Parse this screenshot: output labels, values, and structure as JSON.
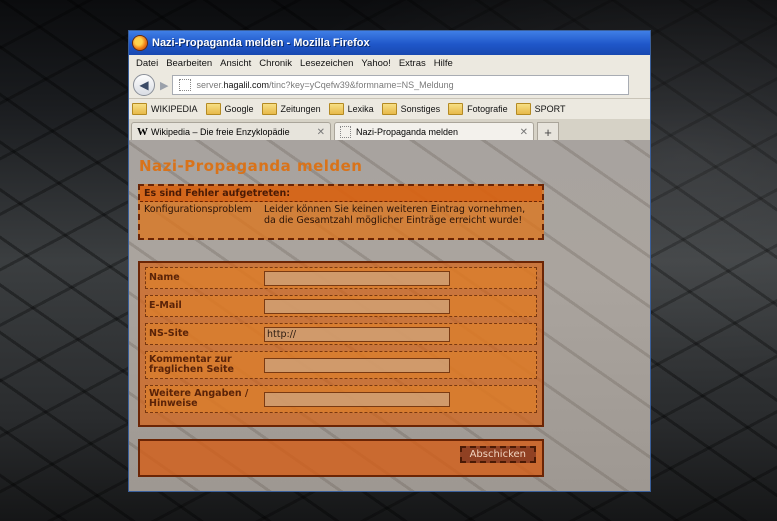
{
  "window": {
    "title": "Nazi-Propaganda melden - Mozilla Firefox"
  },
  "menu": [
    "Datei",
    "Bearbeiten",
    "Ansicht",
    "Chronik",
    "Lesezeichen",
    "Yahoo!",
    "Extras",
    "Hilfe"
  ],
  "url": {
    "prefix": "server.",
    "host": "hagalil.com",
    "path": "/tinc?key=yCqefw39&formname=NS_Meldung"
  },
  "bookmarks": [
    "WIKIPEDIA",
    "Google",
    "Zeitungen",
    "Lexika",
    "Sonstiges",
    "Fotografie",
    "SPORT"
  ],
  "tabs": [
    {
      "label": "Wikipedia – Die freie Enzyklopädie"
    },
    {
      "label": "Nazi-Propaganda melden"
    }
  ],
  "page": {
    "heading": "Nazi-Propaganda melden",
    "error": {
      "header": "Es sind Fehler aufgetreten:",
      "key": "Konfigurationsproblem",
      "message": "Leider können Sie keinen weiteren Eintrag vornehmen, da die Gesamtzahl möglicher Einträge erreicht wurde!"
    },
    "form": {
      "fields": [
        {
          "label": "Name",
          "value": ""
        },
        {
          "label": "E-Mail",
          "value": ""
        },
        {
          "label": "NS-Site",
          "value": "http://"
        },
        {
          "label": "Kommentar zur fraglichen Seite",
          "value": ""
        },
        {
          "label": "Weitere Angaben / Hinweise",
          "value": ""
        }
      ],
      "submit": "Abschicken"
    }
  },
  "colors": {
    "accent": "#d9731a",
    "titlebar": "#2a62d4"
  }
}
